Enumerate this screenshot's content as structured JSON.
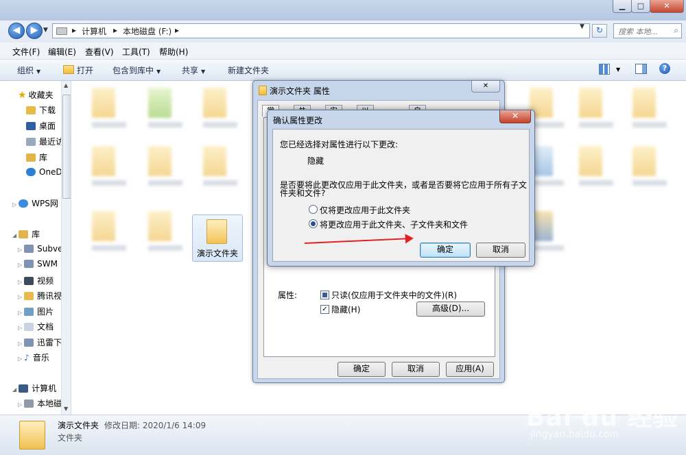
{
  "explorer": {
    "address": {
      "crumb1": "计算机",
      "crumb2": "本地磁盘 (F:)"
    },
    "search_placeholder": "搜索 本地...",
    "menu": [
      "文件(F)",
      "编辑(E)",
      "查看(V)",
      "工具(T)",
      "帮助(H)"
    ],
    "commands": {
      "organize": "组织",
      "open": "打开",
      "include": "包含到库中",
      "share": "共享",
      "new_folder": "新建文件夹"
    },
    "sidebar": {
      "favorites": "收藏夹",
      "fav_items": [
        "下载",
        "桌面",
        "最近访",
        "库",
        "OneD"
      ],
      "wps": "WPS网",
      "libraries": "库",
      "lib_items": [
        "Subve",
        "SWM",
        "视频",
        "腾讯视",
        "图片",
        "文档",
        "迅雷下",
        "音乐"
      ],
      "computer": "计算机",
      "computer_items": [
        "本地磁"
      ]
    },
    "selected_folder": "演示文件夹",
    "status": {
      "name": "演示文件夹",
      "meta": "修改日期: 2020/1/6 14:09",
      "type": "文件夹"
    }
  },
  "properties": {
    "title": "演示文件夹 属性",
    "tabs": [
      "常规",
      "共享",
      "安全",
      "以前的版本",
      "自定义"
    ],
    "attributes_label": "属性:",
    "readonly_label": "只读(仅应用于文件夹中的文件)(R)",
    "hidden_label": "隐藏(H)",
    "advanced_button": "高级(D)...",
    "ok": "确定",
    "cancel": "取消",
    "apply": "应用(A)"
  },
  "confirm": {
    "title": "确认属性更改",
    "line1": "您已经选择对属性进行以下更改:",
    "change": "隐藏",
    "question_line1": "是否要将此更改仅应用于此文件夹，或者是否要将它应用于所有子文",
    "question_line2": "件夹和文件?",
    "option1": "仅将更改应用于此文件夹",
    "option2": "将更改应用于此文件夹、子文件夹和文件",
    "ok": "确定",
    "cancel": "取消"
  },
  "watermark": {
    "brand": "Bai du 经验",
    "url": "jingyan.baidu.com"
  }
}
